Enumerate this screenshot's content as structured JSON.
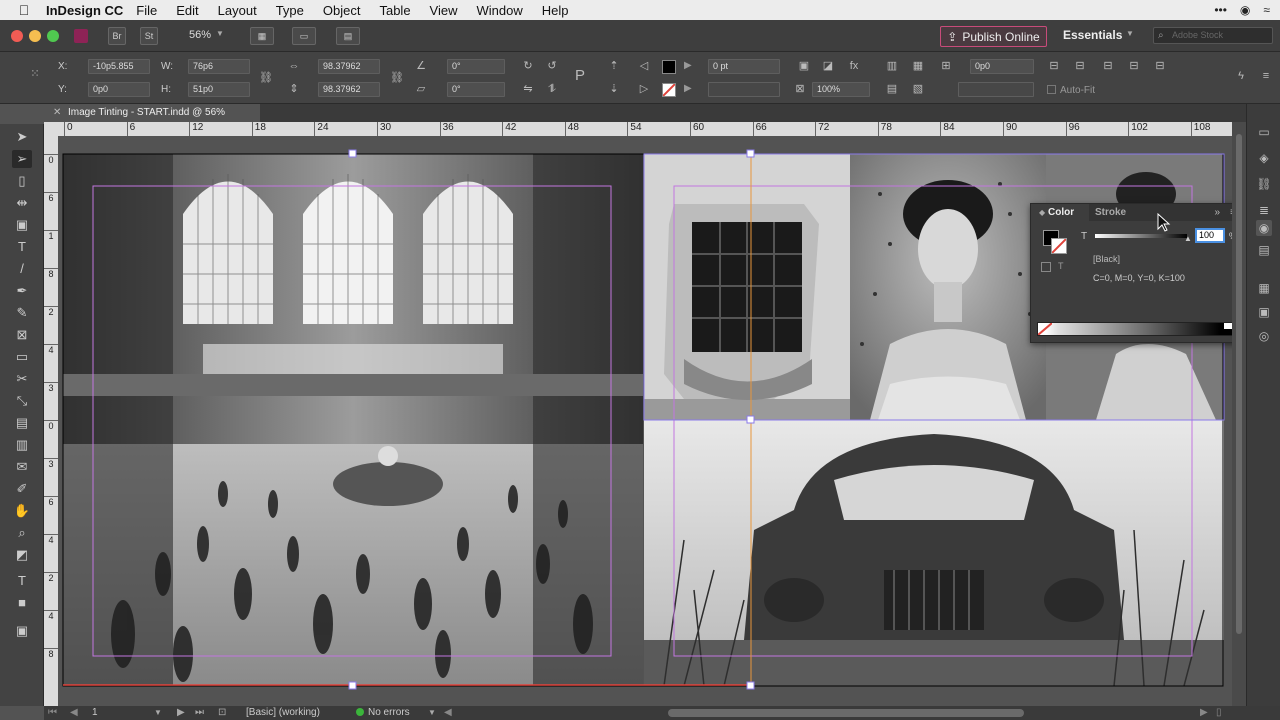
{
  "menubar": {
    "app_name": "InDesign CC",
    "items": [
      "File",
      "Edit",
      "Layout",
      "Type",
      "Object",
      "Table",
      "View",
      "Window",
      "Help"
    ]
  },
  "appbar": {
    "zoom": "56%",
    "publish_label": "Publish Online",
    "workspace": "Essentials",
    "stock_placeholder": "Adobe Stock"
  },
  "control": {
    "x_label": "X:",
    "x_value": "-10p5.855",
    "y_label": "Y:",
    "y_value": "0p0",
    "w_label": "W:",
    "w_value": "76p6",
    "h_label": "H:",
    "h_value": "51p0",
    "scale_x": "98.37962",
    "scale_y": "98.37962",
    "rotate": "0°",
    "shear": "0°",
    "stroke_weight": "0 pt",
    "opacity": "100%",
    "frame_ref": "0p0",
    "autofit_label": "Auto-Fit"
  },
  "document": {
    "tab_title": "Image Tinting - START.indd @ 56%"
  },
  "ruler": {
    "h_ticks": [
      "0",
      "6",
      "12",
      "18",
      "24",
      "30",
      "36",
      "42",
      "48",
      "54",
      "60",
      "66",
      "72",
      "78",
      "84",
      "90",
      "96",
      "102",
      "108"
    ],
    "v_ticks": [
      "0",
      "6",
      "1",
      "8",
      "2",
      "4",
      "3",
      "0",
      "3",
      "6",
      "4",
      "2",
      "4",
      "8"
    ]
  },
  "color_panel": {
    "tab_color": "Color",
    "tab_stroke": "Stroke",
    "tint_label": "T",
    "tint_value": "100",
    "percent": "%",
    "swatch_name": "[Black]",
    "cmyk": "C=0, M=0, Y=0, K=100"
  },
  "statusbar": {
    "page": "1",
    "preflight_profile": "[Basic] (working)",
    "errors": "No errors"
  },
  "colors": {
    "frame_selection": "#8a7ae8",
    "margin_guide": "#c276e0",
    "bleed_guide": "#e0443c",
    "publish_border": "#c84b7a"
  }
}
